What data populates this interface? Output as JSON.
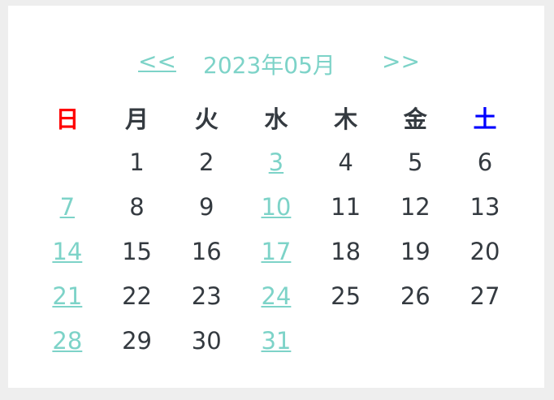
{
  "nav": {
    "prev_label": "<<",
    "title": "2023年05月",
    "next_label": ">>"
  },
  "weekdays": [
    "日",
    "月",
    "火",
    "水",
    "木",
    "金",
    "土"
  ],
  "weeks": [
    [
      "",
      "1",
      "2",
      "3",
      "4",
      "5",
      "6"
    ],
    [
      "7",
      "8",
      "9",
      "10",
      "11",
      "12",
      "13"
    ],
    [
      "14",
      "15",
      "16",
      "17",
      "18",
      "19",
      "20"
    ],
    [
      "21",
      "22",
      "23",
      "24",
      "25",
      "26",
      "27"
    ],
    [
      "28",
      "29",
      "30",
      "31",
      "",
      "",
      ""
    ]
  ],
  "colors": {
    "accent": "#7dd3c8",
    "sunday": "#ff0000",
    "saturday": "#0000ff",
    "text": "#343a40"
  }
}
